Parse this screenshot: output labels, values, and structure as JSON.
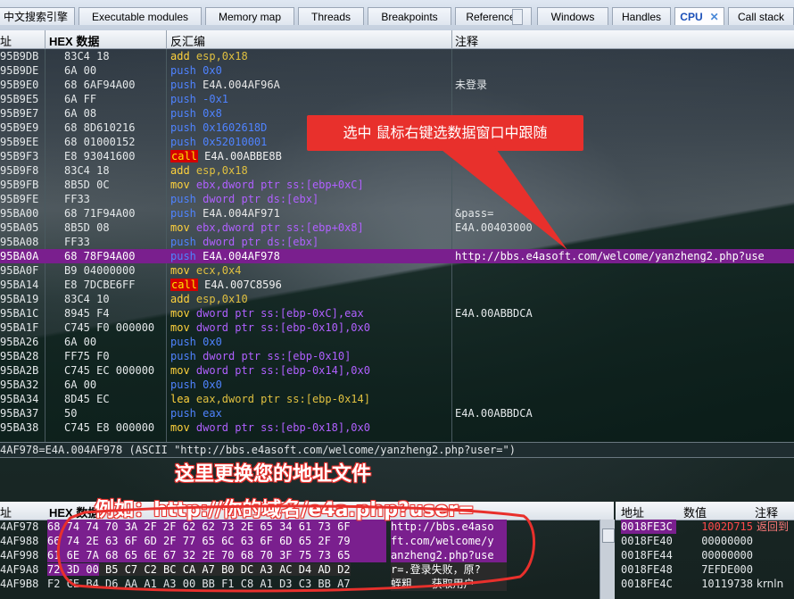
{
  "tabs": [
    {
      "label": "中文搜索引擎"
    },
    {
      "label": "Executable modules"
    },
    {
      "label": "Memory map"
    },
    {
      "label": "Threads"
    },
    {
      "label": "Breakpoints"
    },
    {
      "label": "References"
    },
    {
      "label": "Windows"
    },
    {
      "label": "Handles"
    },
    {
      "label": "CPU",
      "active": true
    },
    {
      "label": "Call stack"
    }
  ],
  "headers": {
    "addr": "址",
    "hex": "HEX 数据",
    "asm": "反汇编",
    "comment": "注释"
  },
  "rows": [
    {
      "addr": "95B9DB",
      "hex": "83C4 18",
      "mn": "add",
      "ops": "esp,0x18",
      "cmt": ""
    },
    {
      "addr": "95B9DE",
      "hex": "6A 00",
      "mn": "push",
      "ops": "0x0",
      "cmt": ""
    },
    {
      "addr": "95B9E0",
      "hex": "68 6AF94A00",
      "mn": "push",
      "ops": "E4A.004AF96A",
      "cmt": "未登录"
    },
    {
      "addr": "95B9E5",
      "hex": "6A FF",
      "mn": "push",
      "ops": "-0x1",
      "cmt": ""
    },
    {
      "addr": "95B9E7",
      "hex": "6A 08",
      "mn": "push",
      "ops": "0x8",
      "cmt": ""
    },
    {
      "addr": "95B9E9",
      "hex": "68 8D610216",
      "mn": "push",
      "ops": "0x1602618D",
      "cmt": ""
    },
    {
      "addr": "95B9EE",
      "hex": "68 01000152",
      "mn": "push",
      "ops": "0x52010001",
      "cmt": ""
    },
    {
      "addr": "95B9F3",
      "hex": "E8 93041600",
      "mn": "call",
      "ops": "E4A.00ABBE8B",
      "cmt": ""
    },
    {
      "addr": "95B9F8",
      "hex": "83C4 18",
      "mn": "add",
      "ops": "esp,0x18",
      "cmt": ""
    },
    {
      "addr": "95B9FB",
      "hex": "8B5D 0C",
      "mn": "mov",
      "ops": "ebx,dword ptr ss:[ebp+0xC]",
      "cmt": ""
    },
    {
      "addr": "95B9FE",
      "hex": "FF33",
      "mn": "push",
      "ops": "dword ptr ds:[ebx]",
      "cmt": ""
    },
    {
      "addr": "95BA00",
      "hex": "68 71F94A00",
      "mn": "push",
      "ops": "E4A.004AF971",
      "cmt": "&pass="
    },
    {
      "addr": "95BA05",
      "hex": "8B5D 08",
      "mn": "mov",
      "ops": "ebx,dword ptr ss:[ebp+0x8]",
      "cmt": "E4A.00403000"
    },
    {
      "addr": "95BA08",
      "hex": "FF33",
      "mn": "push",
      "ops": "dword ptr ds:[ebx]",
      "cmt": ""
    },
    {
      "addr": "95BA0A",
      "hex": "68 78F94A00",
      "mn": "push",
      "ops": "E4A.004AF978",
      "cmt": "http://bbs.e4asoft.com/welcome/yanzheng2.php?use",
      "sel": true
    },
    {
      "addr": "95BA0F",
      "hex": "B9 04000000",
      "mn": "mov",
      "ops": "ecx,0x4",
      "cmt": ""
    },
    {
      "addr": "95BA14",
      "hex": "E8 7DCBE6FF",
      "mn": "call",
      "ops": "E4A.007C8596",
      "cmt": ""
    },
    {
      "addr": "95BA19",
      "hex": "83C4 10",
      "mn": "add",
      "ops": "esp,0x10",
      "cmt": ""
    },
    {
      "addr": "95BA1C",
      "hex": "8945 F4",
      "mn": "mov",
      "ops": "dword ptr ss:[ebp-0xC],eax",
      "cmt": "E4A.00ABBDCA"
    },
    {
      "addr": "95BA1F",
      "hex": "C745 F0 000000",
      "mn": "mov",
      "ops": "dword ptr ss:[ebp-0x10],0x0",
      "cmt": ""
    },
    {
      "addr": "95BA26",
      "hex": "6A 00",
      "mn": "push",
      "ops": "0x0",
      "cmt": ""
    },
    {
      "addr": "95BA28",
      "hex": "FF75 F0",
      "mn": "push",
      "ops": "dword ptr ss:[ebp-0x10]",
      "cmt": ""
    },
    {
      "addr": "95BA2B",
      "hex": "C745 EC 000000",
      "mn": "mov",
      "ops": "dword ptr ss:[ebp-0x14],0x0",
      "cmt": ""
    },
    {
      "addr": "95BA32",
      "hex": "6A 00",
      "mn": "push",
      "ops": "0x0",
      "cmt": ""
    },
    {
      "addr": "95BA34",
      "hex": "8D45 EC",
      "mn": "lea",
      "ops": "eax,dword ptr ss:[ebp-0x14]",
      "cmt": ""
    },
    {
      "addr": "95BA37",
      "hex": "50",
      "mn": "push",
      "ops": "eax",
      "cmt": "E4A.00ABBDCA"
    },
    {
      "addr": "95BA38",
      "hex": "C745 E8 000000",
      "mn": "mov",
      "ops": "dword ptr ss:[ebp-0x18],0x0",
      "cmt": ""
    }
  ],
  "info_line": "4AF978=E4A.004AF978 (ASCII \"http://bbs.e4asoft.com/welcome/yanzheng2.php?user=\")",
  "callout": "选中 鼠标右键选数据窗口中跟随",
  "anno_title": "这里更换您的地址文件",
  "anno_example": "例如：http://你的域名/e4a.php?user=",
  "dump_headers": {
    "addr": "址",
    "hex": "HEX 数据"
  },
  "dump_rows": [
    {
      "addr": "4AF978",
      "hex": "68 74 74 70 3A 2F 2F 62 62 73 2E 65 34 61 73 6F",
      "ascii": "http://bbs.e4aso"
    },
    {
      "addr": "4AF988",
      "hex": "66 74 2E 63 6F 6D 2F 77 65 6C 63 6F 6D 65 2F 79",
      "ascii": "ft.com/welcome/y"
    },
    {
      "addr": "4AF998",
      "hex": "61 6E 7A 68 65 6E 67 32 2E 70 68 70 3F 75 73 65",
      "ascii": "anzheng2.php?use"
    },
    {
      "addr": "4AF9A8",
      "hex": "72 3D 00 B5 C7 C2 BC CA A7 B0 DC A3 AC D4 AD D2",
      "ascii": "r=.登录失败，原?"
    },
    {
      "addr": "4AF9B8",
      "hex": "F2 CE B4 D6 AA A1 A3 00 BB F1 C8 A1 D3 C3 BB A7",
      "ascii": "蛭粗...获取用户"
    }
  ],
  "stack_headers": {
    "addr": "地址",
    "value": "数值",
    "comment": "注释"
  },
  "stack_rows": [
    {
      "addr": "0018FE3C",
      "value": "1002D715",
      "comment": "返回到"
    },
    {
      "addr": "0018FE40",
      "value": "00000000",
      "comment": ""
    },
    {
      "addr": "0018FE44",
      "value": "00000000",
      "comment": ""
    },
    {
      "addr": "0018FE48",
      "value": "7EFDE000",
      "comment": ""
    },
    {
      "addr": "0018FE4C",
      "value": "10119738",
      "comment": "krnln"
    }
  ]
}
